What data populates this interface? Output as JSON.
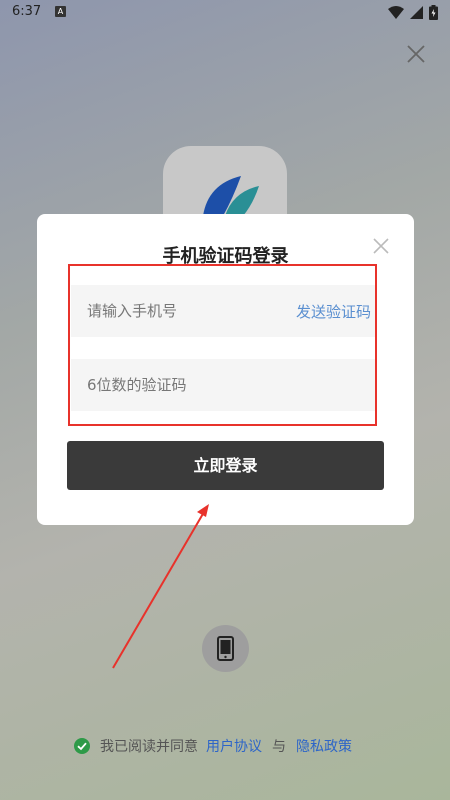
{
  "status_bar": {
    "time": "6:37",
    "notif_letter": "A"
  },
  "dialog": {
    "title": "手机验证码登录",
    "phone_placeholder": "请输入手机号",
    "send_code_label": "发送验证码",
    "code_placeholder": "6位数的验证码",
    "login_button_label": "立即登录"
  },
  "agreement": {
    "prefix": "我已阅读并同意",
    "user_agreement": "用户协议",
    "and": "与",
    "privacy_policy": "隐私政策"
  },
  "colors": {
    "highlight": "#e8322b",
    "link": "#2d65c8",
    "send_code": "#5a8fd0",
    "login_button": "#3a3a3a",
    "check": "#2e9a48"
  }
}
